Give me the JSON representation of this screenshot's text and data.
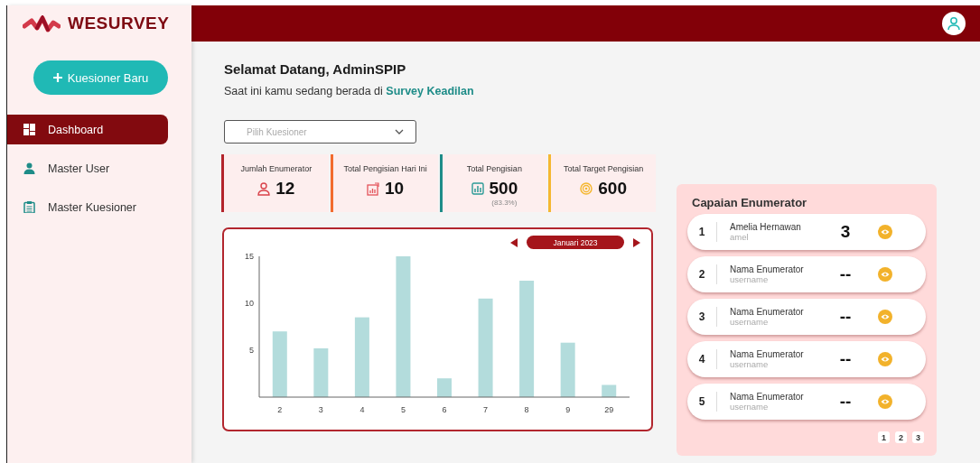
{
  "sidebar": {
    "logo": "WESURVEY",
    "new_button": "Kuesioner Baru",
    "items": [
      {
        "label": "Dashboard",
        "kind": "dashboard",
        "selected": true
      },
      {
        "label": "Master User",
        "kind": "user",
        "selected": false
      },
      {
        "label": "Master Kuesioner",
        "kind": "clipboard",
        "selected": false
      }
    ]
  },
  "greeting": {
    "title": "Selamat Datang, AdminSPIP",
    "subtitle": "Saat ini kamu sedang berada di **Survey Keadilan**"
  },
  "questionnaire_select": {
    "placeholder": "Pilih Kuesioner"
  },
  "stats": [
    {
      "label": "Jumlah Enumerator",
      "value": "12",
      "kind": "person",
      "color": "#b3232b"
    },
    {
      "label": "Total Pengisian Hari Ini",
      "value": "10",
      "kind": "growth",
      "color": "#f26b2e"
    },
    {
      "label": "Total Pengisian",
      "value": "500",
      "note": "(83.3%)",
      "kind": "bars",
      "color": "#1e8c88"
    },
    {
      "label": "Total Target Pengisian",
      "value": "600",
      "kind": "target",
      "color": "#f5b731"
    }
  ],
  "chart": {
    "month": "Januari 2023",
    "chart_data": {
      "type": "bar",
      "categories": [
        "2",
        "3",
        "4",
        "5",
        "6",
        "7",
        "8",
        "9",
        "29"
      ],
      "series": [
        {
          "color": "#b3dcdc",
          "values": [
            7,
            5.2,
            8.5,
            15,
            2,
            10.5,
            12.4,
            5.8,
            1.3
          ]
        }
      ],
      "ylim": [
        0,
        15
      ],
      "yticks": [
        5,
        10,
        15
      ]
    }
  },
  "ranking": {
    "title": "Capaian Enumerator",
    "rows": [
      {
        "rank": "1",
        "name": "Amelia Hernawan",
        "username": "amel",
        "score": "3"
      },
      {
        "rank": "2",
        "name": "Nama Enumerator",
        "username": "username",
        "score": "--"
      },
      {
        "rank": "3",
        "name": "Nama Enumerator",
        "username": "username",
        "score": "--"
      },
      {
        "rank": "4",
        "name": "Nama Enumerator",
        "username": "username",
        "score": "--"
      },
      {
        "rank": "5",
        "name": "Nama Enumerator",
        "username": "username",
        "score": "--"
      }
    ],
    "pages": [
      "1",
      "2",
      "3"
    ]
  }
}
